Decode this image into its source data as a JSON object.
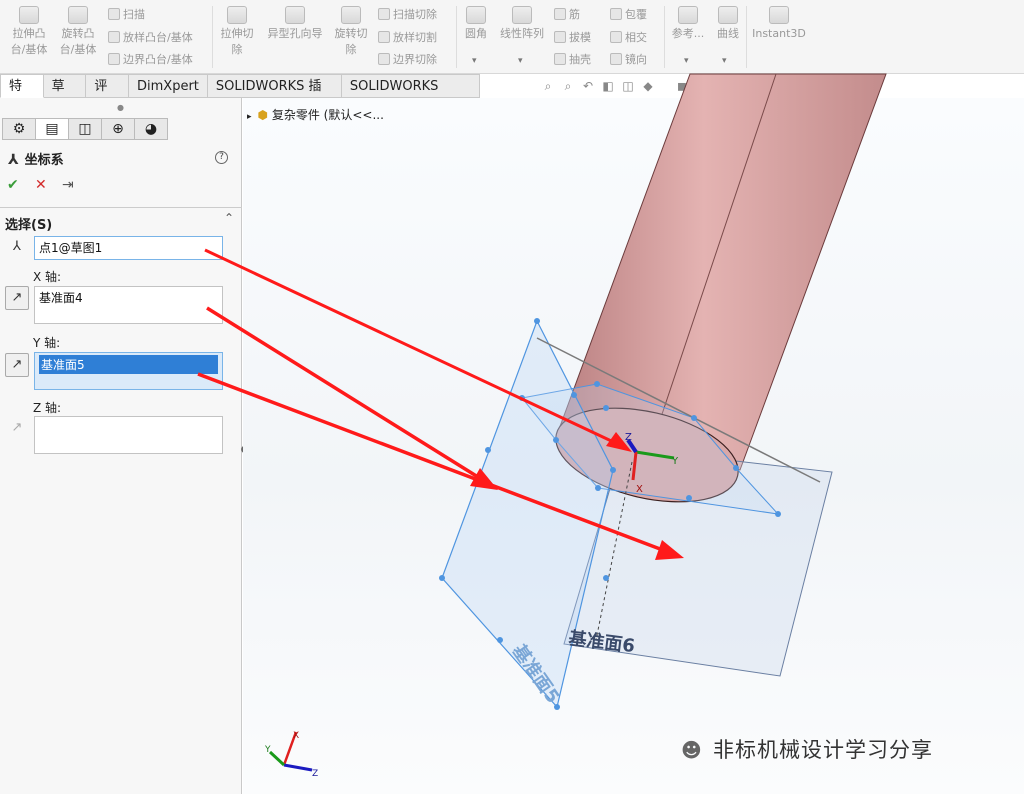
{
  "ribbon": {
    "col1": {
      "line1": "拉伸凸",
      "line2": "台/基体"
    },
    "col2": {
      "line1": "旋转凸",
      "line2": "台/基体"
    },
    "small1": [
      "扫描",
      "放样凸台/基体",
      "边界凸台/基体"
    ],
    "col3": {
      "line1": "拉伸切",
      "line2": "除"
    },
    "col4": {
      "line1": "异型孔向导",
      "line2": ""
    },
    "col5": {
      "line1": "旋转切",
      "line2": "除"
    },
    "small2": [
      "扫描切除",
      "放样切割",
      "边界切除"
    ],
    "col6": {
      "line1": "圆角"
    },
    "col7": {
      "line1": "线性阵列"
    },
    "small3": [
      "筋",
      "拔模",
      "抽壳"
    ],
    "small4": [
      "包覆",
      "相交",
      "镜向"
    ],
    "col8": {
      "line1": "参考..."
    },
    "col9": {
      "line1": "曲线"
    },
    "col10": {
      "line1": "Instant3D"
    }
  },
  "tabs": [
    "特征",
    "草图",
    "评估",
    "DimXpert",
    "SOLIDWORKS 插件",
    "SOLIDWORKS MBD"
  ],
  "panel": {
    "title": "坐标系",
    "ok_icon": "check-icon",
    "cancel_icon": "x-icon",
    "pin_icon": "pushpin-icon",
    "selection_header": "选择(S)",
    "origin_field": "点1@草图1",
    "x_axis_label": "X 轴:",
    "x_axis_value": "基准面4",
    "y_axis_label": "Y 轴:",
    "y_axis_value": "基准面5",
    "z_axis_label": "Z 轴:",
    "z_axis_value": ""
  },
  "tree": {
    "root": "复杂零件  (默认<<..."
  },
  "viewport": {
    "plane5_label": "基准面5",
    "plane6_label": "基准面6",
    "triad_x": "X",
    "triad_y": "Y",
    "triad_z": "Z",
    "cs_x": "X",
    "cs_y": "Y",
    "cs_z": "Z",
    "arrow_color": "#ff1a1a",
    "cylinder_color": "#d9a3a3",
    "plane_color": "#3d8fe0"
  },
  "watermark": "非标机械设计学习分享"
}
